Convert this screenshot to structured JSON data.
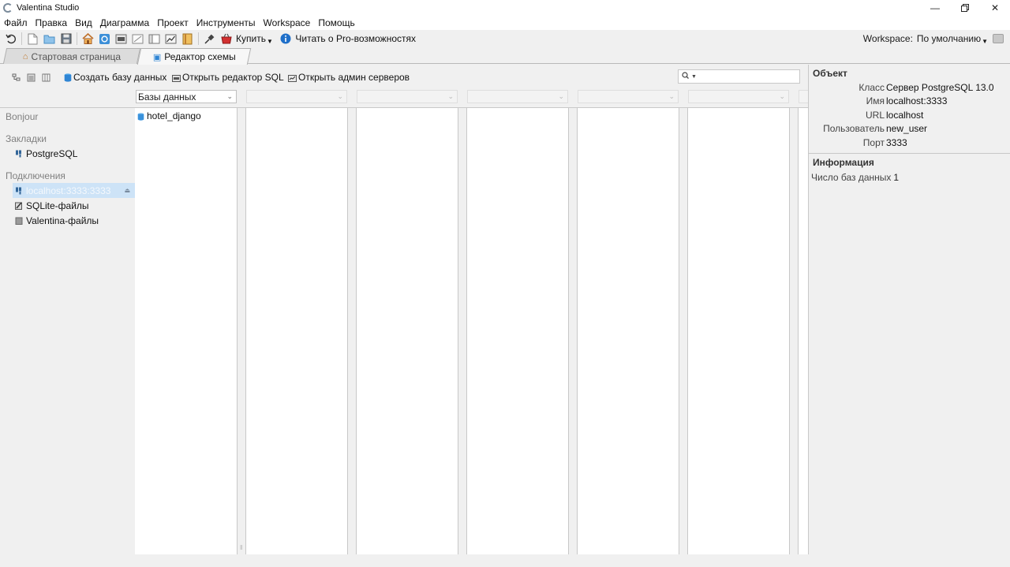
{
  "window": {
    "title": "Valentina Studio",
    "controls": [
      "minimize-icon",
      "restore-icon",
      "close-icon"
    ]
  },
  "menu": [
    "Файл",
    "Правка",
    "Вид",
    "Диаграмма",
    "Проект",
    "Инструменты",
    "Workspace",
    "Помощь"
  ],
  "toolbar": {
    "buy_label": "Купить",
    "pro_label": "Читать о Pro-возможностях",
    "workspace_label": "Workspace:",
    "workspace_value": "По умолчанию"
  },
  "tabs": [
    {
      "label": "Стартовая страница",
      "icon": "home-icon",
      "active": false
    },
    {
      "label": "Редактор схемы",
      "icon": "schema-icon",
      "active": true
    }
  ],
  "actions": {
    "create_db": "Создать базу данных",
    "open_sql": "Открыть редактор SQL",
    "open_admin": "Открыть админ серверов"
  },
  "search": {
    "placeholder": ""
  },
  "combos": {
    "databases": "Базы данных"
  },
  "sidebar": {
    "bonjour": "Bonjour",
    "bookmarks_title": "Закладки",
    "bookmarks": [
      "PostgreSQL"
    ],
    "connections_title": "Подключения",
    "connections": [
      {
        "label": "localhost:3333:3333",
        "selected": true
      },
      {
        "label": "SQLite-файлы",
        "selected": false
      },
      {
        "label": "Valentina-файлы",
        "selected": false
      }
    ]
  },
  "columns": {
    "databases": [
      "hotel_django"
    ]
  },
  "object_panel": {
    "title": "Объект",
    "rows": [
      {
        "key": "Класс",
        "value": "Сервер PostgreSQL 13.0"
      },
      {
        "key": "Имя",
        "value": "localhost:3333"
      },
      {
        "key": "URL",
        "value": "localhost"
      },
      {
        "key": "Пользователь",
        "value": "new_user"
      },
      {
        "key": "Порт",
        "value": "3333"
      }
    ]
  },
  "info_panel": {
    "title": "Информация",
    "db_count_label": "Число баз данных",
    "db_count": "1"
  },
  "colors": {
    "selection": "#cde3f7",
    "accent": "#1f7fd6",
    "buy_red": "#d23030"
  }
}
